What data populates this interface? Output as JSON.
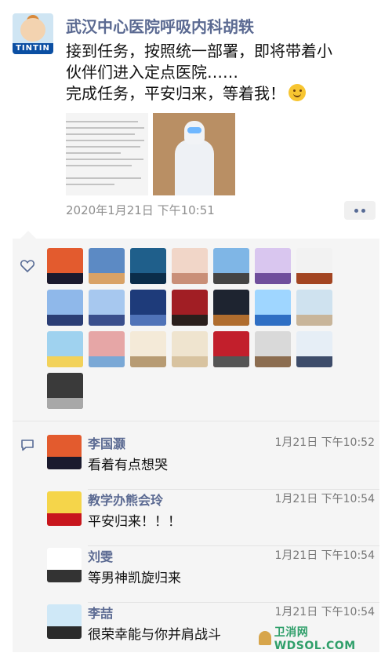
{
  "post": {
    "author": "武汉中心医院呼吸内科胡轶",
    "avatar_text": "TINTIN",
    "lines": [
      "接到任务，按照统一部署，即将带着小",
      "伙伴们进入定点医院……",
      "完成任务，平安归来，等着我！"
    ],
    "time": "2020年1月21日 下午10:51"
  },
  "likes": {
    "icon": "heart-icon",
    "avatars": [
      {
        "top": "#e35b2e",
        "bottom": "#1a1a2e"
      },
      {
        "top": "#5c8ac4",
        "bottom": "#d9a266"
      },
      {
        "top": "#1f5f8b",
        "bottom": "#0b2d4a"
      },
      {
        "top": "#f1d6c8",
        "bottom": "#c98f78"
      },
      {
        "top": "#7fb6e6",
        "bottom": "#444444"
      },
      {
        "top": "#d9c6ef",
        "bottom": "#6f4e9c"
      },
      {
        "top": "#f2f2f2",
        "bottom": "#a34522"
      },
      {
        "top": "#8fb8ea",
        "bottom": "#2b3e75"
      },
      {
        "top": "#a7c8ef",
        "bottom": "#3a4f8c"
      },
      {
        "top": "#1e3b7a",
        "bottom": "#5073b8"
      },
      {
        "top": "#a11e24",
        "bottom": "#2a1f1c"
      },
      {
        "top": "#1e2430",
        "bottom": "#b06d2e"
      },
      {
        "top": "#9fd6ff",
        "bottom": "#2f6fc4"
      },
      {
        "top": "#cfe2ef",
        "bottom": "#c8b59a"
      },
      {
        "top": "#9fd2ef",
        "bottom": "#f2d25a"
      },
      {
        "top": "#e6a6a6",
        "bottom": "#7aa8d6"
      },
      {
        "top": "#f4ead8",
        "bottom": "#b79b73"
      },
      {
        "top": "#efe4cf",
        "bottom": "#d8c3a0"
      },
      {
        "top": "#c21f2c",
        "bottom": "#555555"
      },
      {
        "top": "#d9d9d9",
        "bottom": "#8c6d50"
      },
      {
        "top": "#e6eef6",
        "bottom": "#3d4c6a"
      },
      {
        "top": "#3a3a3a",
        "bottom": "#a8a8a8"
      }
    ]
  },
  "comments": {
    "icon": "comment-bubble-icon",
    "items": [
      {
        "name": "李国灏",
        "time": "1月21日 下午10:52",
        "text": "看着有点想哭",
        "avatar_top": "#e35b2e",
        "avatar_bottom": "#1a1a2e"
      },
      {
        "name": "教学办熊会玲",
        "time": "1月21日 下午10:54",
        "text": "平安归来！！！",
        "avatar_top": "#f5d54a",
        "avatar_bottom": "#c8161d"
      },
      {
        "name": "刘雯",
        "time": "1月21日 下午10:54",
        "text": "等男神凯旋归来",
        "avatar_top": "#ffffff",
        "avatar_bottom": "#333333"
      },
      {
        "name": "李喆",
        "time": "1月21日 下午10:54",
        "text": "很荣幸能与你并肩战斗",
        "avatar_top": "#cfe8f7",
        "avatar_bottom": "#2b2b2b"
      }
    ]
  },
  "watermark": {
    "text": "卫消网 WDSOL.COM"
  }
}
